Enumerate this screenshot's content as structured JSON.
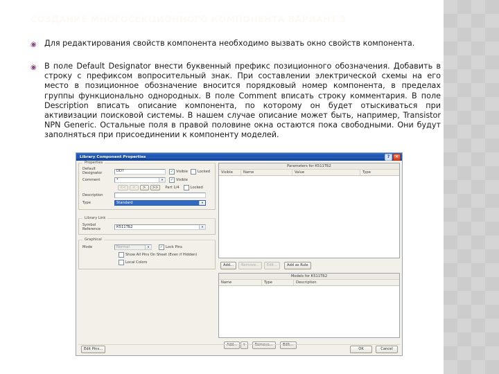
{
  "slide": {
    "title": "СОЗДАНИЕ МНОГОСЕКЦИОННОГО КОМПОНЕНТА ВАРИАНТ 3",
    "title_color": "#fdfaf4",
    "bullet_glyph": "◉",
    "bullet_color": "#8c4a7e",
    "bullets": [
      "Для редактирования свойств компонента необходимо вызвать окно свойств компонента.",
      "В поле Default Designator внести буквенный префикс позиционного обозначения. Добавить в строку с префиксом вопросительный знак. При составлении электрической схемы на его место в позиционное обозначение вносится порядковый номер компонента, в пределах группы функционально однородных. В поле Comment вписать строку комментария. В поле Description вписать описание компонента, по которому он будет отыскиваться при активизации поисковой системы. В нашем случае описание может быть, например, Transistor NPN Generic. Остальные поля в правой половине окна остаются пока свободными. Они будут заполняться при присоединении к компоненту моделей."
    ]
  },
  "dialog": {
    "title": "Library Component Properties",
    "help_glyph": "?",
    "close_glyph": "✕",
    "properties": {
      "legend": "Properties",
      "default_designator_label": "Default Designator",
      "default_designator_value": "DD?",
      "designator_visible_label": "Visible",
      "designator_visible_checked": true,
      "designator_locked_label": "Locked",
      "designator_locked_checked": false,
      "comment_label": "Comment",
      "comment_value": "*",
      "comment_visible_label": "Visible",
      "comment_visible_checked": true,
      "nav_first": "<<",
      "nav_prev": "<",
      "nav_next": ">",
      "nav_last": ">>",
      "part_label": "Part 1/4",
      "part_locked_label": "Locked",
      "part_locked_checked": false,
      "description_label": "Description",
      "description_value": "",
      "type_label": "Type",
      "type_value": "Standard"
    },
    "library_link": {
      "legend": "Library Link",
      "symbol_reference_label": "Symbol Reference",
      "symbol_reference_value": "К511ТБ2"
    },
    "graphical": {
      "legend": "Graphical",
      "mode_label": "Mode",
      "mode_value": "Normal",
      "lock_pins_label": "Lock Pins",
      "lock_pins_checked": true,
      "show_all_pins_label": "Show All Pins On Sheet (Even if Hidden)",
      "show_all_pins_checked": false,
      "local_colors_label": "Local Colors",
      "local_colors_checked": false
    },
    "parameters": {
      "caption": "Parameters for К511ТБ2",
      "columns": [
        "Visible",
        "Name",
        "Value",
        "Type"
      ],
      "rows": [],
      "buttons": {
        "add": "Add...",
        "remove": "Remove...",
        "edit": "Edit...",
        "add_as_rule": "Add as Rule"
      }
    },
    "models": {
      "caption": "Models for К511ТБ2",
      "columns": [
        "Name",
        "Type",
        "Description"
      ],
      "rows": [],
      "buttons": {
        "add": "Add...",
        "add_arrow": "▾",
        "remove": "Remove...",
        "edit": "Edit..."
      }
    },
    "footer": {
      "edit_pins": "Edit Pins...",
      "ok": "OK",
      "cancel": "Cancel"
    }
  }
}
